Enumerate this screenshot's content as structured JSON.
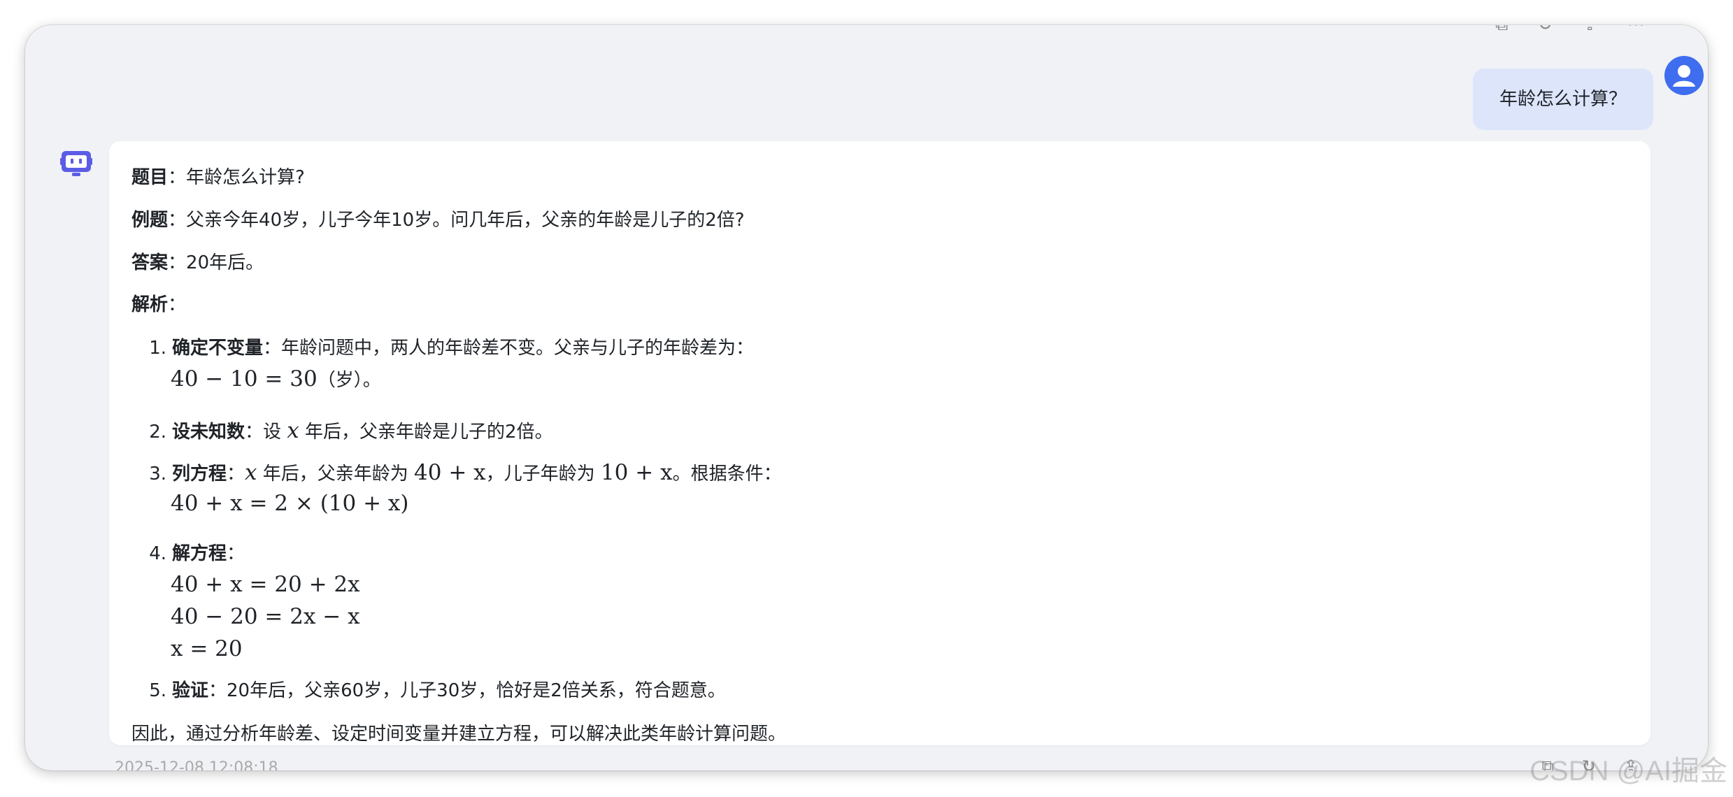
{
  "user_message": "年龄怎么计算？",
  "answer": {
    "title_label": "题目",
    "title_text": "年龄怎么计算?",
    "example_label": "例题",
    "example_text": "父亲今年40岁，儿子今年10岁。问几年后，父亲的年龄是儿子的2倍?",
    "answer_label": "答案",
    "answer_text": "20年后。",
    "analysis_label": "解析",
    "steps": [
      {
        "num": "1.",
        "label": "确定不变量",
        "text": "年龄问题中，两人的年龄差不变。父亲与儿子的年龄差为：",
        "math1": "40 − 10 = 30",
        "math1_suffix": "（岁）。"
      },
      {
        "num": "2.",
        "label": "设未知数",
        "text_a": "设 ",
        "var": "x",
        "text_b": " 年后，父亲年龄是儿子的2倍。"
      },
      {
        "num": "3.",
        "label": "列方程",
        "var": "x",
        "text_a": " 年后，父亲年龄为 ",
        "expr1": "40 + x",
        "text_b": "，儿子年龄为 ",
        "expr2": "10 + x",
        "text_c": "。根据条件：",
        "math1": "40 + x = 2 × (10 + x)"
      },
      {
        "num": "4.",
        "label": "解方程",
        "text": "：",
        "math1": "40 + x = 20 + 2x",
        "math2": "40 − 20 = 2x − x",
        "math3": "x = 20"
      },
      {
        "num": "5.",
        "label": "验证",
        "text": "：20年后，父亲60岁，儿子30岁，恰好是2倍关系，符合题意。"
      }
    ],
    "conclusion": "因此，通过分析年龄差、设定时间变量并建立方程，可以解决此类年龄计算问题。"
  },
  "bottom_timestamp": "2025-12-08 12:08:18",
  "watermark": "CSDN @AI掘金",
  "colors": {
    "user_bubble": "#dde5fb",
    "avatar": "#3f6df0",
    "bot_icon": "#5b5ce6",
    "background": "#f1f2f6"
  },
  "icons": [
    "user-avatar-icon",
    "bot-icon",
    "copy-icon",
    "refresh-icon",
    "share-icon",
    "more-icon"
  ]
}
